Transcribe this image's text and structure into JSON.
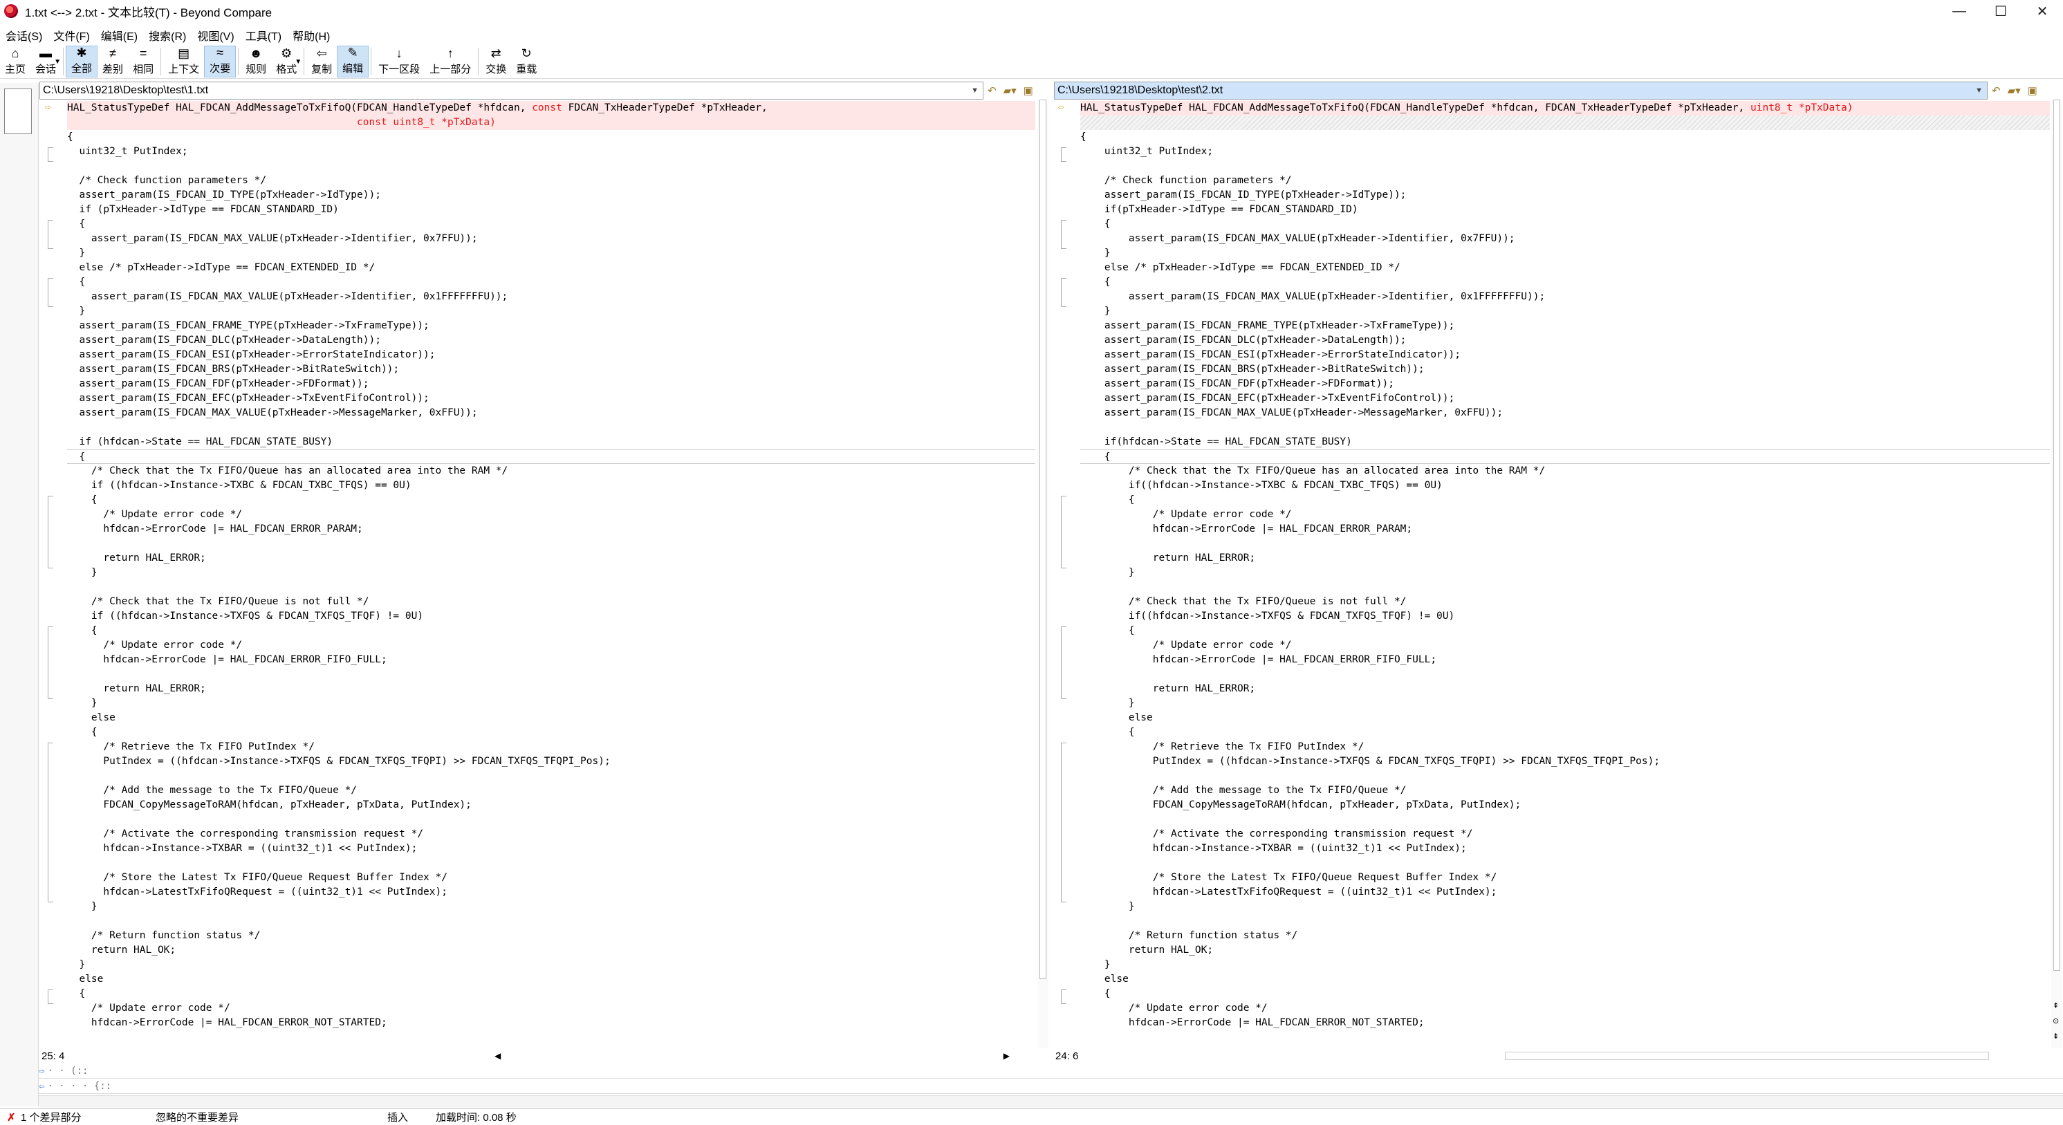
{
  "window": {
    "title": "1.txt <--> 2.txt - 文本比较(T) - Beyond Compare"
  },
  "menu": [
    "会话(S)",
    "文件(F)",
    "编辑(E)",
    "搜索(R)",
    "视图(V)",
    "工具(T)",
    "帮助(H)"
  ],
  "toolbar": [
    {
      "label": "主页",
      "icon": "⌂",
      "name": "home"
    },
    {
      "label": "会话",
      "icon": "▬",
      "name": "session",
      "dropdown": true
    },
    {
      "sep": true
    },
    {
      "label": "全部",
      "icon": "✱",
      "name": "all",
      "active": true
    },
    {
      "label": "差别",
      "icon": "≠",
      "name": "diffs"
    },
    {
      "label": "相同",
      "icon": "=",
      "name": "same"
    },
    {
      "sep": true
    },
    {
      "label": "上下文",
      "icon": "▤",
      "name": "context"
    },
    {
      "label": "次要",
      "icon": "≈",
      "name": "minor",
      "active": true
    },
    {
      "sep": true
    },
    {
      "label": "规则",
      "icon": "☻",
      "name": "rules"
    },
    {
      "label": "格式",
      "icon": "⚙",
      "name": "format",
      "dropdown": true
    },
    {
      "sep": true
    },
    {
      "label": "复制",
      "icon": "⇦",
      "name": "copy"
    },
    {
      "label": "编辑",
      "icon": "✎",
      "name": "edit",
      "active": true
    },
    {
      "sep": true
    },
    {
      "label": "下一区段",
      "icon": "↓",
      "name": "next-section"
    },
    {
      "label": "上一部分",
      "icon": "↑",
      "name": "prev-section"
    },
    {
      "sep": true
    },
    {
      "label": "交换",
      "icon": "⇄",
      "name": "swap"
    },
    {
      "label": "重载",
      "icon": "↻",
      "name": "reload"
    }
  ],
  "left": {
    "path": "C:\\Users\\19218\\Desktop\\test\\1.txt",
    "position": "25: 4",
    "lines": [
      {
        "t": "HAL_StatusTypeDef HAL_FDCAN_AddMessageToTxFifoQ(FDCAN_HandleTypeDef *hfdcan, ",
        "r": "const",
        "t2": " FDCAN_TxHeaderTypeDef *pTxHeader,",
        "cls": "diff",
        "mark": true
      },
      {
        "t": "                                                ",
        "r": "const uint8_t *pTxData)",
        "t2": "",
        "cls": "diff"
      },
      {
        "t": "{"
      },
      {
        "t": "  uint32_t PutIndex;"
      },
      {
        "t": ""
      },
      {
        "t": "  /* Check function parameters */"
      },
      {
        "t": "  assert_param(IS_FDCAN_ID_TYPE(pTxHeader->IdType));"
      },
      {
        "t": "  if (pTxHeader->IdType == FDCAN_STANDARD_ID)"
      },
      {
        "t": "  {"
      },
      {
        "t": "    assert_param(IS_FDCAN_MAX_VALUE(pTxHeader->Identifier, 0x7FFU));"
      },
      {
        "t": "  }"
      },
      {
        "t": "  else /* pTxHeader->IdType == FDCAN_EXTENDED_ID */"
      },
      {
        "t": "  {"
      },
      {
        "t": "    assert_param(IS_FDCAN_MAX_VALUE(pTxHeader->Identifier, 0x1FFFFFFFU));"
      },
      {
        "t": "  }"
      },
      {
        "t": "  assert_param(IS_FDCAN_FRAME_TYPE(pTxHeader->TxFrameType));"
      },
      {
        "t": "  assert_param(IS_FDCAN_DLC(pTxHeader->DataLength));"
      },
      {
        "t": "  assert_param(IS_FDCAN_ESI(pTxHeader->ErrorStateIndicator));"
      },
      {
        "t": "  assert_param(IS_FDCAN_BRS(pTxHeader->BitRateSwitch));"
      },
      {
        "t": "  assert_param(IS_FDCAN_FDF(pTxHeader->FDFormat));"
      },
      {
        "t": "  assert_param(IS_FDCAN_EFC(pTxHeader->TxEventFifoControl));"
      },
      {
        "t": "  assert_param(IS_FDCAN_MAX_VALUE(pTxHeader->MessageMarker, 0xFFU));"
      },
      {
        "t": ""
      },
      {
        "t": "  if (hfdcan->State == HAL_FDCAN_STATE_BUSY)"
      },
      {
        "t": "  {",
        "cls": "cur"
      },
      {
        "t": "    /* Check that the Tx FIFO/Queue has an allocated area into the RAM */"
      },
      {
        "t": "    if ((hfdcan->Instance->TXBC & FDCAN_TXBC_TFQS) == 0U)"
      },
      {
        "t": "    {"
      },
      {
        "t": "      /* Update error code */"
      },
      {
        "t": "      hfdcan->ErrorCode |= HAL_FDCAN_ERROR_PARAM;"
      },
      {
        "t": ""
      },
      {
        "t": "      return HAL_ERROR;"
      },
      {
        "t": "    }"
      },
      {
        "t": ""
      },
      {
        "t": "    /* Check that the Tx FIFO/Queue is not full */"
      },
      {
        "t": "    if ((hfdcan->Instance->TXFQS & FDCAN_TXFQS_TFQF) != 0U)"
      },
      {
        "t": "    {"
      },
      {
        "t": "      /* Update error code */"
      },
      {
        "t": "      hfdcan->ErrorCode |= HAL_FDCAN_ERROR_FIFO_FULL;"
      },
      {
        "t": ""
      },
      {
        "t": "      return HAL_ERROR;"
      },
      {
        "t": "    }"
      },
      {
        "t": "    else"
      },
      {
        "t": "    {"
      },
      {
        "t": "      /* Retrieve the Tx FIFO PutIndex */"
      },
      {
        "t": "      PutIndex = ((hfdcan->Instance->TXFQS & FDCAN_TXFQS_TFQPI) >> FDCAN_TXFQS_TFQPI_Pos);"
      },
      {
        "t": ""
      },
      {
        "t": "      /* Add the message to the Tx FIFO/Queue */"
      },
      {
        "t": "      FDCAN_CopyMessageToRAM(hfdcan, pTxHeader, pTxData, PutIndex);"
      },
      {
        "t": ""
      },
      {
        "t": "      /* Activate the corresponding transmission request */"
      },
      {
        "t": "      hfdcan->Instance->TXBAR = ((uint32_t)1 << PutIndex);"
      },
      {
        "t": ""
      },
      {
        "t": "      /* Store the Latest Tx FIFO/Queue Request Buffer Index */"
      },
      {
        "t": "      hfdcan->LatestTxFifoQRequest = ((uint32_t)1 << PutIndex);"
      },
      {
        "t": "    }"
      },
      {
        "t": ""
      },
      {
        "t": "    /* Return function status */"
      },
      {
        "t": "    return HAL_OK;"
      },
      {
        "t": "  }"
      },
      {
        "t": "  else"
      },
      {
        "t": "  {"
      },
      {
        "t": "    /* Update error code */"
      },
      {
        "t": "    hfdcan->ErrorCode |= HAL_FDCAN_ERROR_NOT_STARTED;"
      }
    ]
  },
  "right": {
    "path": "C:\\Users\\19218\\Desktop\\test\\2.txt",
    "position": "24: 6",
    "lines": [
      {
        "t": "HAL_StatusTypeDef HAL_FDCAN_AddMessageToTxFifoQ(FDCAN_HandleTypeDef *hfdcan, FDCAN_TxHeaderTypeDef *pTxHeader, ",
        "r": "uint8_t *pTxData)",
        "t2": "",
        "cls": "diff",
        "mark": true
      },
      {
        "t": "",
        "cls": "hatch"
      },
      {
        "t": "{"
      },
      {
        "t": "    uint32_t PutIndex;"
      },
      {
        "t": ""
      },
      {
        "t": "    /* Check function parameters */"
      },
      {
        "t": "    assert_param(IS_FDCAN_ID_TYPE(pTxHeader->IdType));"
      },
      {
        "t": "    if(pTxHeader->IdType == FDCAN_STANDARD_ID)"
      },
      {
        "t": "    {"
      },
      {
        "t": "        assert_param(IS_FDCAN_MAX_VALUE(pTxHeader->Identifier, 0x7FFU));"
      },
      {
        "t": "    }"
      },
      {
        "t": "    else /* pTxHeader->IdType == FDCAN_EXTENDED_ID */"
      },
      {
        "t": "    {"
      },
      {
        "t": "        assert_param(IS_FDCAN_MAX_VALUE(pTxHeader->Identifier, 0x1FFFFFFFU));"
      },
      {
        "t": "    }"
      },
      {
        "t": "    assert_param(IS_FDCAN_FRAME_TYPE(pTxHeader->TxFrameType));"
      },
      {
        "t": "    assert_param(IS_FDCAN_DLC(pTxHeader->DataLength));"
      },
      {
        "t": "    assert_param(IS_FDCAN_ESI(pTxHeader->ErrorStateIndicator));"
      },
      {
        "t": "    assert_param(IS_FDCAN_BRS(pTxHeader->BitRateSwitch));"
      },
      {
        "t": "    assert_param(IS_FDCAN_FDF(pTxHeader->FDFormat));"
      },
      {
        "t": "    assert_param(IS_FDCAN_EFC(pTxHeader->TxEventFifoControl));"
      },
      {
        "t": "    assert_param(IS_FDCAN_MAX_VALUE(pTxHeader->MessageMarker, 0xFFU));"
      },
      {
        "t": ""
      },
      {
        "t": "    if(hfdcan->State == HAL_FDCAN_STATE_BUSY)"
      },
      {
        "t": "    {",
        "cls": "cur"
      },
      {
        "t": "        /* Check that the Tx FIFO/Queue has an allocated area into the RAM */"
      },
      {
        "t": "        if((hfdcan->Instance->TXBC & FDCAN_TXBC_TFQS) == 0U)"
      },
      {
        "t": "        {"
      },
      {
        "t": "            /* Update error code */"
      },
      {
        "t": "            hfdcan->ErrorCode |= HAL_FDCAN_ERROR_PARAM;"
      },
      {
        "t": ""
      },
      {
        "t": "            return HAL_ERROR;"
      },
      {
        "t": "        }"
      },
      {
        "t": ""
      },
      {
        "t": "        /* Check that the Tx FIFO/Queue is not full */"
      },
      {
        "t": "        if((hfdcan->Instance->TXFQS & FDCAN_TXFQS_TFQF) != 0U)"
      },
      {
        "t": "        {"
      },
      {
        "t": "            /* Update error code */"
      },
      {
        "t": "            hfdcan->ErrorCode |= HAL_FDCAN_ERROR_FIFO_FULL;"
      },
      {
        "t": ""
      },
      {
        "t": "            return HAL_ERROR;"
      },
      {
        "t": "        }"
      },
      {
        "t": "        else"
      },
      {
        "t": "        {"
      },
      {
        "t": "            /* Retrieve the Tx FIFO PutIndex */"
      },
      {
        "t": "            PutIndex = ((hfdcan->Instance->TXFQS & FDCAN_TXFQS_TFQPI) >> FDCAN_TXFQS_TFQPI_Pos);"
      },
      {
        "t": ""
      },
      {
        "t": "            /* Add the message to the Tx FIFO/Queue */"
      },
      {
        "t": "            FDCAN_CopyMessageToRAM(hfdcan, pTxHeader, pTxData, PutIndex);"
      },
      {
        "t": ""
      },
      {
        "t": "            /* Activate the corresponding transmission request */"
      },
      {
        "t": "            hfdcan->Instance->TXBAR = ((uint32_t)1 << PutIndex);"
      },
      {
        "t": ""
      },
      {
        "t": "            /* Store the Latest Tx FIFO/Queue Request Buffer Index */"
      },
      {
        "t": "            hfdcan->LatestTxFifoQRequest = ((uint32_t)1 << PutIndex);"
      },
      {
        "t": "        }"
      },
      {
        "t": ""
      },
      {
        "t": "        /* Return function status */"
      },
      {
        "t": "        return HAL_OK;"
      },
      {
        "t": "    }"
      },
      {
        "t": "    else"
      },
      {
        "t": "    {"
      },
      {
        "t": "        /* Update error code */"
      },
      {
        "t": "        hfdcan->ErrorCode |= HAL_FDCAN_ERROR_NOT_STARTED;"
      }
    ]
  },
  "lower": {
    "line1": "· · (::",
    "line2": "· · · · {::"
  },
  "status": {
    "diff_count": "1 个差异部分",
    "ignored": "忽略的不重要差异",
    "mode": "插入",
    "load_time": "加载时间:  0.08 秒"
  }
}
